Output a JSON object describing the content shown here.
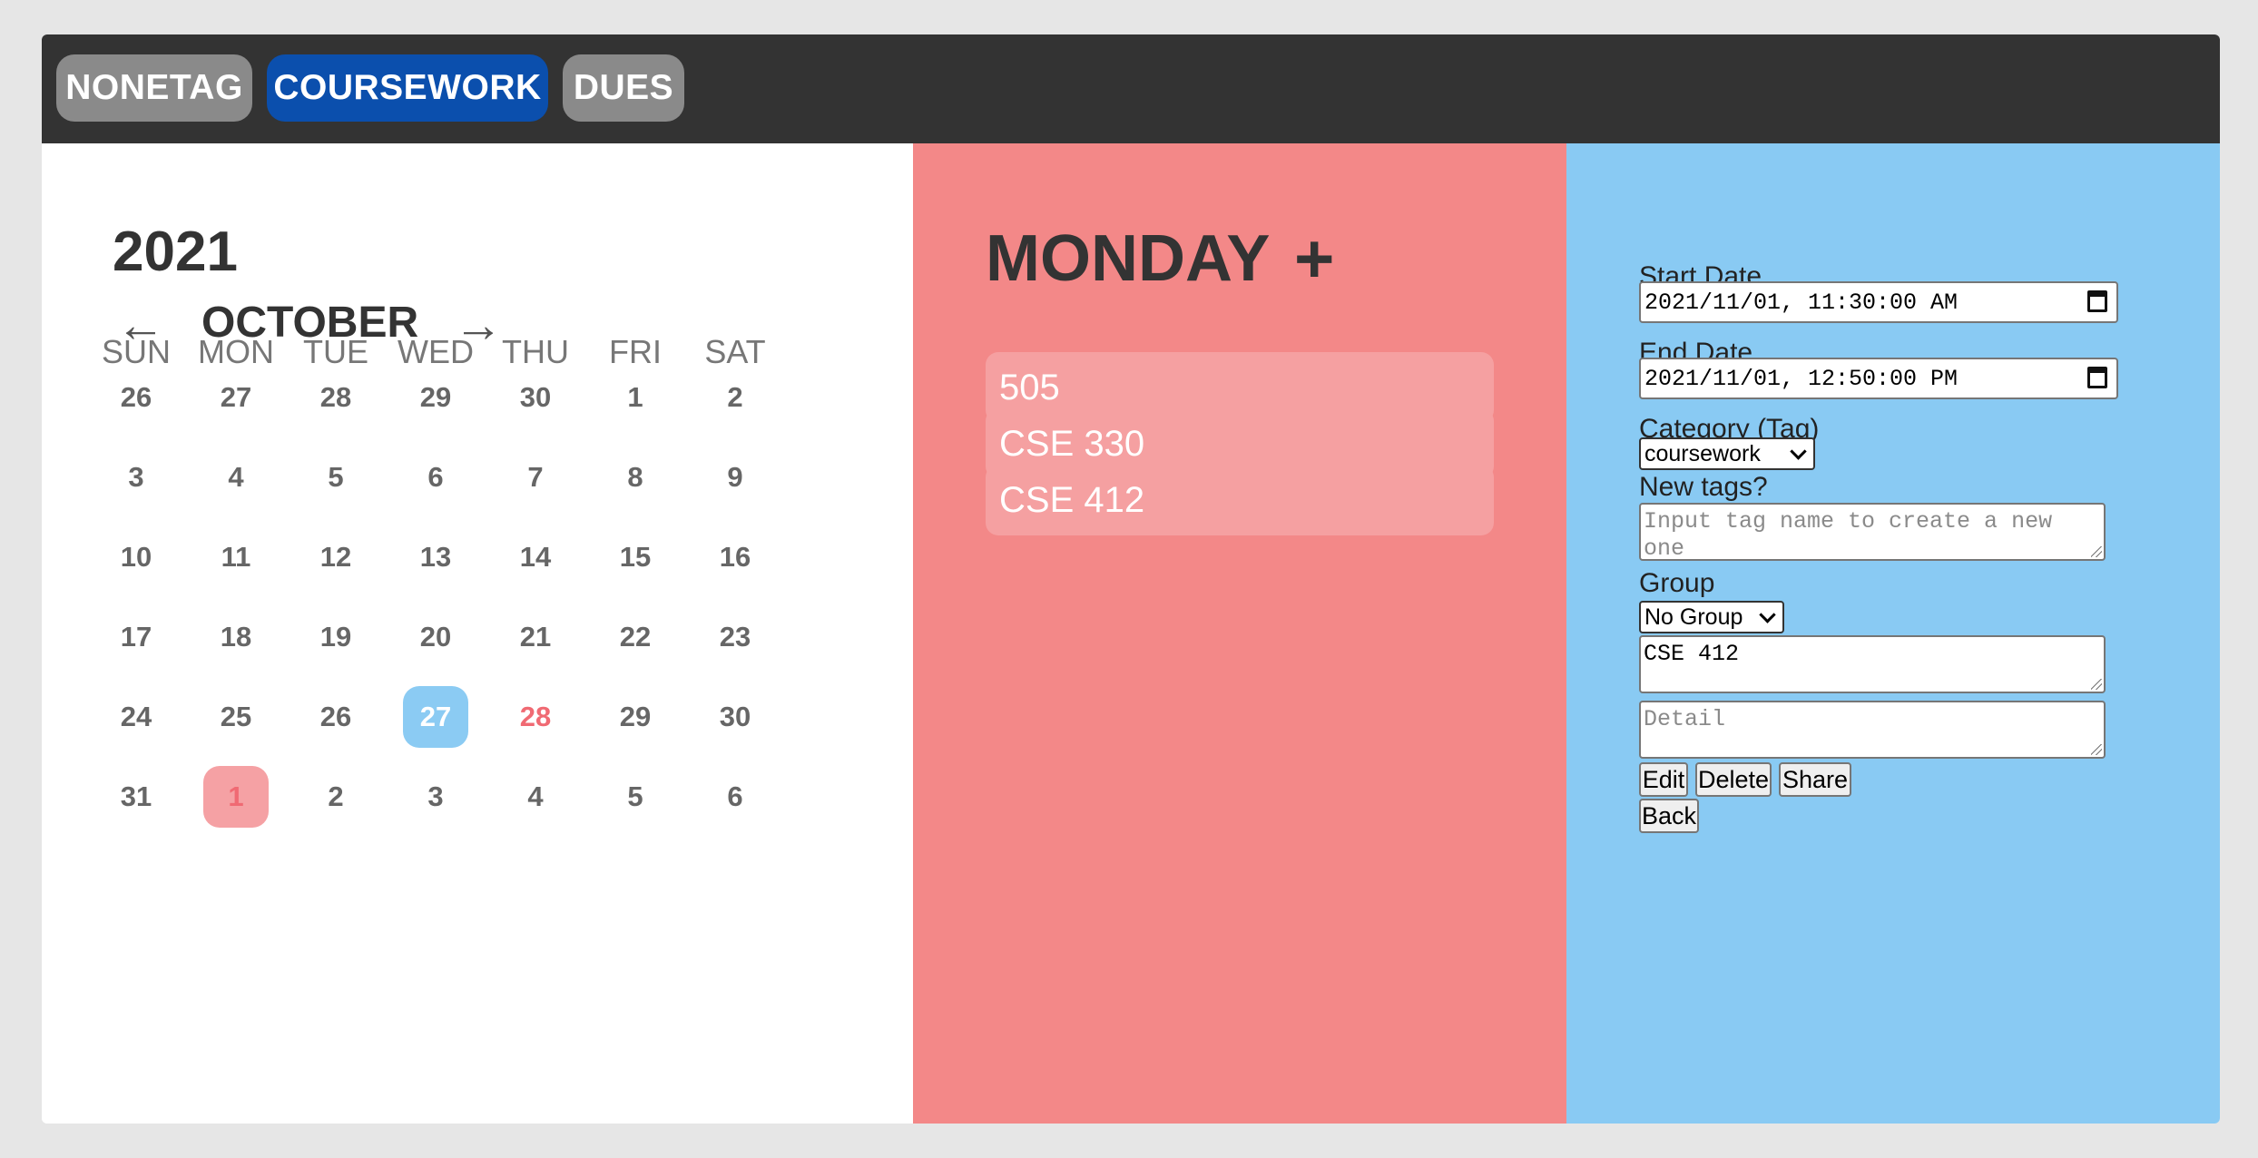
{
  "tags": [
    {
      "label": "NONETAG",
      "active": false
    },
    {
      "label": "COURSEWORK",
      "active": true
    },
    {
      "label": "DUES",
      "active": false
    }
  ],
  "calendar": {
    "year": "2021",
    "month": "OCTOBER",
    "prev_arrow": "←",
    "next_arrow": "→",
    "weekdays": [
      "SUN",
      "MON",
      "TUE",
      "WED",
      "THU",
      "FRI",
      "SAT"
    ],
    "weeks": [
      [
        "26",
        "27",
        "28",
        "29",
        "30",
        "1",
        "2"
      ],
      [
        "3",
        "4",
        "5",
        "6",
        "7",
        "8",
        "9"
      ],
      [
        "10",
        "11",
        "12",
        "13",
        "14",
        "15",
        "16"
      ],
      [
        "17",
        "18",
        "19",
        "20",
        "21",
        "22",
        "23"
      ],
      [
        "24",
        "25",
        "26",
        "27",
        "28",
        "29",
        "30"
      ],
      [
        "31",
        "1",
        "2",
        "3",
        "4",
        "5",
        "6"
      ]
    ],
    "today": "27",
    "highlighted": "28",
    "selected": "1"
  },
  "day_panel": {
    "day_name": "MONDAY",
    "add_label": "+",
    "events": [
      "505",
      "CSE 330",
      "CSE 412"
    ]
  },
  "editor": {
    "start_label": "Start Date",
    "start_value": "2021/11/01, 11:30:00 AM",
    "end_label": "End Date",
    "end_value": "2021/11/01, 12:50:00 PM",
    "category_label": "Category (Tag)",
    "category_value": "coursework",
    "new_tags_label": "New tags?",
    "new_tags_placeholder": "Input tag name to create a new one",
    "group_label": "Group",
    "group_value": "No Group",
    "title_value": "CSE 412",
    "detail_placeholder": "Detail",
    "edit_label": "Edit",
    "delete_label": "Delete",
    "share_label": "Share",
    "back_label": "Back"
  },
  "colors": {
    "topbar": "#333333",
    "tag_active": "#0b4fad",
    "tag_inactive": "#8a8a8a",
    "day_panel": "#f38888",
    "editor_panel": "#89caf3",
    "today": "#8bcbf3",
    "selected": "#f5a1a4"
  }
}
